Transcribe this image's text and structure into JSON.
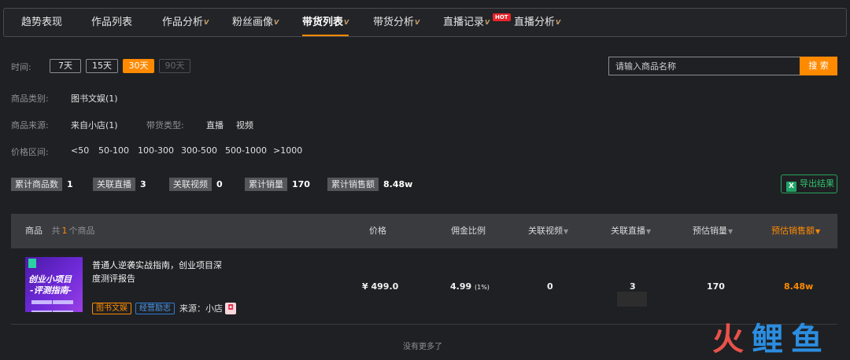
{
  "tabs": [
    {
      "label": "趋势表现",
      "vip": false
    },
    {
      "label": "作品列表",
      "vip": false
    },
    {
      "label": "作品分析",
      "vip": true
    },
    {
      "label": "粉丝画像",
      "vip": true
    },
    {
      "label": "带货列表",
      "vip": true,
      "active": true
    },
    {
      "label": "带货分析",
      "vip": true
    },
    {
      "label": "直播记录",
      "vip": true,
      "badge": "HOT"
    },
    {
      "label": "直播分析",
      "vip": true
    }
  ],
  "vip_icon_text": "V",
  "filters": {
    "time_label": "时间:",
    "time_options": [
      "7天",
      "15天",
      "30天",
      "90天"
    ],
    "time_selected": "30天",
    "category_label": "商品类别:",
    "category_value": "图书文娱(1)",
    "source_label": "商品来源:",
    "source_value": "来自小店(1)",
    "type_label": "带货类型:",
    "type_options": [
      "直播",
      "视频"
    ],
    "price_label": "价格区间:",
    "price_options": [
      "<50",
      "50-100",
      "100-300",
      "300-500",
      "500-1000",
      ">1000"
    ]
  },
  "search": {
    "placeholder": "请输入商品名称",
    "button_label": "搜 索"
  },
  "stats": [
    {
      "label": "累计商品数",
      "value": "1"
    },
    {
      "label": "关联直播",
      "value": "3"
    },
    {
      "label": "关联视频",
      "value": "0"
    },
    {
      "label": "累计销量",
      "value": "170"
    },
    {
      "label": "累计销售额",
      "value": "8.48w"
    }
  ],
  "export_label": "导出结果",
  "table": {
    "headers": {
      "product": "商品",
      "count_prefix": "共",
      "count": "1",
      "count_suffix": "个商品",
      "price": "价格",
      "commission": "佣金比例",
      "videos": "关联视频",
      "lives": "关联直播",
      "est_sales": "预估销量",
      "est_revenue": "预估销售额"
    },
    "rows": [
      {
        "title": "普通人逆袭实战指南，创业项目深度测评报告",
        "thumb_line1": "创业小项目",
        "thumb_line2": "-评测指南-",
        "tags": [
          "图书文娱",
          "经营励志"
        ],
        "source": "来源：小店",
        "price": "¥ 499.0",
        "commission": "4.99",
        "commission_pct": "(1%)",
        "videos": "0",
        "lives": "3",
        "est_sales": "170",
        "est_revenue": "8.48w"
      }
    ]
  },
  "no_more": "没有更多了",
  "watermark": {
    "c1": "火",
    "c2": "鲤",
    "c3": "鱼"
  }
}
